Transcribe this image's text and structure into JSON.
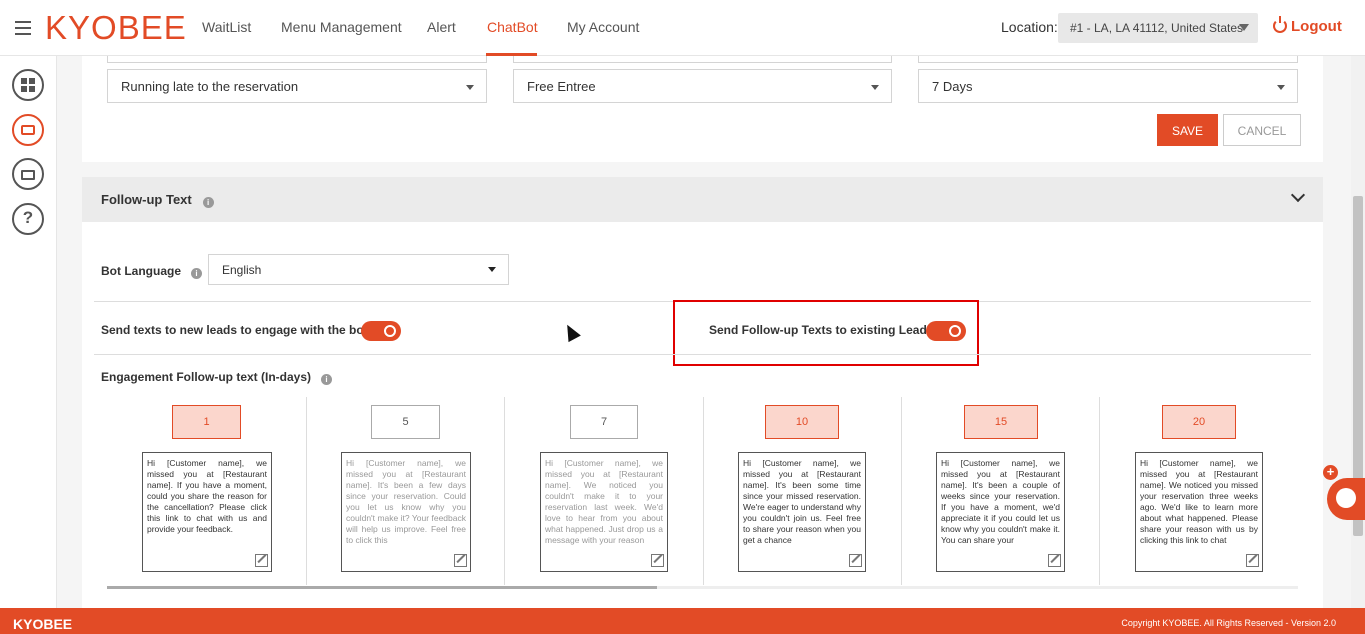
{
  "app": {
    "logo": "KYOBEE",
    "nav": [
      "WaitList",
      "Menu Management",
      "Alert",
      "ChatBot",
      "My Account"
    ],
    "active_nav": "ChatBot",
    "location_label": "Location:",
    "location_value": "#1 - LA, LA 41112, United States",
    "logout_label": "Logout",
    "accent_color": "#e24b26"
  },
  "sidebar": {
    "icons": [
      "dashboard-icon",
      "robot-icon",
      "cake-icon",
      "help-icon"
    ],
    "help_glyph": "?"
  },
  "reservation_panel": {
    "reason_value": "Running late to the reservation",
    "offer_value": "Free Entree",
    "duration_value": "7 Days",
    "save_label": "SAVE",
    "cancel_label": "CANCEL"
  },
  "followup": {
    "title": "Follow-up Text",
    "info_glyph": "i",
    "bot_language_label": "Bot Language",
    "bot_language_value": "English",
    "new_leads_label": "Send texts to new leads to engage with the bot",
    "new_leads_enabled": true,
    "existing_leads_label": "Send Follow-up Texts to existing Leads",
    "existing_leads_enabled": true,
    "engagement_label": "Engagement Follow-up text (In-days)",
    "days": [
      {
        "day": "1",
        "highlighted": true,
        "message": "Hi [Customer name], we missed you at [Restaurant name]. If you have a moment, could you share the reason for the cancellation? Please click this link to chat with us and provide your feedback."
      },
      {
        "day": "5",
        "highlighted": false,
        "message": "Hi [Customer name], we missed you at [Restaurant name]. It's been a few days since your reservation. Could you let us know why you couldn't make it? Your feedback will help us improve. Feel free to click this"
      },
      {
        "day": "7",
        "highlighted": false,
        "message": "Hi [Customer name], we missed you at [Restaurant name]. We noticed you couldn't make it to your reservation last week. We'd love to hear from you about what happened. Just drop us a message with your reason"
      },
      {
        "day": "10",
        "highlighted": true,
        "message": "Hi [Customer name], we missed you at [Restaurant name]. It's been some time since your missed reservation. We're eager to understand why you couldn't join us. Feel free to share your reason when you get a chance"
      },
      {
        "day": "15",
        "highlighted": true,
        "message": "Hi [Customer name], we missed you at [Restaurant name]. It's been a couple of weeks since your reservation. If you have a moment, we'd appreciate it if you could let us know why you couldn't make it. You can share your"
      },
      {
        "day": "20",
        "highlighted": true,
        "message": "Hi [Customer name], we missed you at [Restaurant name]. We noticed you missed your reservation three weeks ago. We'd like to learn more about what happened. Please share your reason with us by clicking this link to chat"
      }
    ]
  },
  "widgets": {
    "plus_glyph": "+"
  },
  "footer": {
    "logo": "KYOBEE",
    "copyright": "Copyright KYOBEE. All Rights Reserved - Version 2.0"
  }
}
